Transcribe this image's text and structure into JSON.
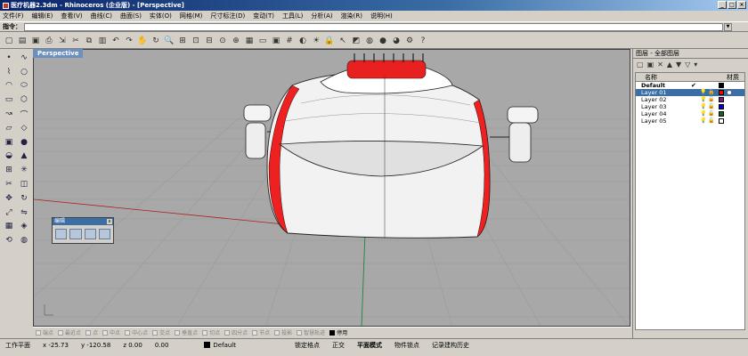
{
  "window": {
    "title": "医疗机器2.3dm - Rhinoceros (企业版) - [Perspective]"
  },
  "menu": [
    "文件(F)",
    "编辑(E)",
    "查看(V)",
    "曲线(C)",
    "曲面(S)",
    "实体(O)",
    "网格(M)",
    "尺寸标注(D)",
    "变动(T)",
    "工具(L)",
    "分析(A)",
    "渲染(R)",
    "说明(H)"
  ],
  "command": {
    "label": "指令：",
    "value": ""
  },
  "toolbar_icons": [
    "new-icon",
    "open-icon",
    "save-icon",
    "print-icon",
    "import-icon",
    "cut-icon",
    "copy-icon",
    "paste-icon",
    "undo-icon",
    "redo-icon",
    "pan-icon",
    "rotate-view-icon",
    "zoom-icon",
    "zoom-window-icon",
    "zoom-extents-icon",
    "zoom-selected-icon",
    "zoom-target-icon",
    "cplane-icon",
    "four-view-icon",
    "viewport-icon",
    "named-view-icon",
    "grid-snap-icon",
    "hide-icon",
    "light-icon",
    "lock-icon",
    "select-icon",
    "layer-icon",
    "color-icon",
    "render-icon",
    "material-icon",
    "settings-icon",
    "help-icon"
  ],
  "left_tools": [
    "point-icon",
    "curve-icon",
    "polyline-icon",
    "circle-icon",
    "arc-icon",
    "ellipse-icon",
    "rectangle-icon",
    "polygon-icon",
    "curve-edit-icon",
    "fillet-icon",
    "surface-icon",
    "loft-icon",
    "box-icon",
    "sphere-icon",
    "boolean-icon",
    "extrude-icon",
    "join-icon",
    "explode-icon",
    "trim-icon",
    "split-icon",
    "move-icon",
    "rotate-icon",
    "scale-icon",
    "mirror-icon",
    "array-icon",
    "patch-icon",
    "transform-icon",
    "render-tool-icon"
  ],
  "viewport": {
    "label": "Perspective"
  },
  "floating_panel": {
    "title": "编辑",
    "close": "x"
  },
  "osnaps": [
    {
      "label": "端点",
      "checked": false
    },
    {
      "label": "最近点",
      "checked": false
    },
    {
      "label": "点",
      "checked": false
    },
    {
      "label": "中点",
      "checked": false
    },
    {
      "label": "中心点",
      "checked": false
    },
    {
      "label": "交点",
      "checked": false
    },
    {
      "label": "垂直点",
      "checked": false
    },
    {
      "label": "切点",
      "checked": false
    },
    {
      "label": "四分点",
      "checked": false
    },
    {
      "label": "节点",
      "checked": false
    },
    {
      "label": "投影",
      "checked": false
    },
    {
      "label": "智慧轨迹",
      "checked": false
    },
    {
      "label": "停用",
      "checked": true
    }
  ],
  "status": {
    "cplane": "工作平面",
    "x": "x -25.73",
    "y": "y -120.58",
    "z": "z 0.00",
    "extra": "0.00",
    "layer": "Default",
    "grid_snap": "锁定格点",
    "ortho": "正交",
    "planar": "平面模式",
    "object_snap": "物件锁点",
    "history": "记录建构历史"
  },
  "layers_panel": {
    "title": "图层 - 全部图层",
    "col_name": "名称",
    "col_material": "材质",
    "layers": [
      {
        "name": "Default",
        "current": true,
        "selected": false,
        "color": "#000000"
      },
      {
        "name": "Layer 01",
        "current": false,
        "selected": true,
        "color": "#ff0000"
      },
      {
        "name": "Layer 02",
        "current": false,
        "selected": false,
        "color": "#7a1e7a"
      },
      {
        "name": "Layer 03",
        "current": false,
        "selected": false,
        "color": "#0000cc"
      },
      {
        "name": "Layer 04",
        "current": false,
        "selected": false,
        "color": "#0a6b1f"
      },
      {
        "name": "Layer 05",
        "current": false,
        "selected": false,
        "color": "#ffffff"
      }
    ]
  }
}
